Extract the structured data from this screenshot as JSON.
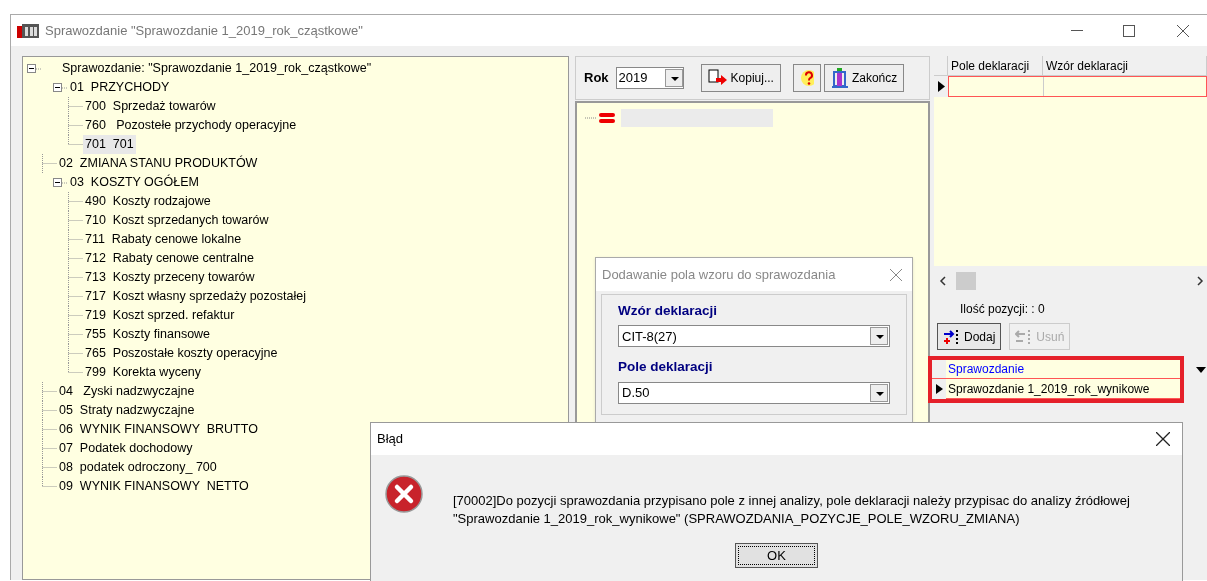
{
  "window": {
    "title": "Sprawozdanie \"Sprawozdanie 1_2019_rok_cząstkowe\""
  },
  "tree": {
    "items": [
      {
        "label": "Sprawozdanie: \"Sprawozdanie 1_2019_rok_cząstkowe\"",
        "expanded": true,
        "selected": false,
        "children": [
          {
            "label": "01  PRZYCHODY",
            "expanded": true,
            "selected": false,
            "children": [
              {
                "label": "700  Sprzedaż towarów",
                "selected": false
              },
              {
                "label": "760   Pozostełe przychody operacyjne",
                "selected": false
              },
              {
                "label": "701  701",
                "selected": true
              }
            ]
          },
          {
            "label": "02  ZMIANA STANU PRODUKTÓW",
            "selected": false
          },
          {
            "label": "03  KOSZTY OGÓŁEM",
            "expanded": true,
            "selected": false,
            "children": [
              {
                "label": "490  Koszty rodzajowe",
                "selected": false
              },
              {
                "label": "710  Koszt sprzedanych towarów",
                "selected": false
              },
              {
                "label": "711  Rabaty cenowe lokalne",
                "selected": false
              },
              {
                "label": "712  Rabaty cenowe centralne",
                "selected": false
              },
              {
                "label": "713  Koszty przeceny towarów",
                "selected": false
              },
              {
                "label": "717  Koszt własny sprzedaży pozostałej",
                "selected": false
              },
              {
                "label": "719  Koszt sprzed. refaktur",
                "selected": false
              },
              {
                "label": "755  Koszty finansowe",
                "selected": false
              },
              {
                "label": "765  Poszostałe koszty operacyjne",
                "selected": false
              },
              {
                "label": "799  Korekta wyceny",
                "selected": false
              }
            ]
          },
          {
            "label": "04   Zyski nadzwyczajne",
            "selected": false
          },
          {
            "label": "05  Straty nadzwyczajne",
            "selected": false
          },
          {
            "label": "06  WYNIK FINANSOWY  BRUTTO",
            "selected": false
          },
          {
            "label": "07  Podatek dochodowy",
            "selected": false
          },
          {
            "label": "08  podatek odroczony_ 700",
            "selected": false
          },
          {
            "label": "09  WYNIK FINANSOWY  NETTO",
            "selected": false
          }
        ]
      }
    ]
  },
  "toolbar": {
    "year_label": "Rok",
    "year": "2019",
    "buttons": [
      {
        "kind": "copy",
        "label": "Kopiuj..."
      },
      {
        "kind": "help"
      },
      {
        "kind": "close",
        "label": "Zakończ"
      }
    ]
  },
  "declaration_grid": {
    "columns": [
      "Pole deklaracji",
      "Wzór deklaracji"
    ]
  },
  "count_label": "Ilość pozycji: : 0",
  "actions": [
    {
      "kind": "add",
      "label": "Dodaj",
      "disabled": false
    },
    {
      "kind": "remove",
      "label": "Usuń",
      "disabled": true
    }
  ],
  "report_grid": {
    "columns": [
      "Sprawozdanie"
    ],
    "rows": [
      "Sprawozdanie 1_2019_rok_wynikowe"
    ]
  },
  "add_dialog": {
    "title": "Dodawanie pola wzoru do sprawozdania",
    "fields": [
      {
        "label": "Wzór deklaracji",
        "value": "CIT-8(27)"
      },
      {
        "label": "Pole deklaracji",
        "value": "D.50"
      }
    ]
  },
  "error_dialog": {
    "title": "Błąd",
    "message": "[70002]Do pozycji sprawozdania przypisano pole z innej analizy, pole deklaracji należy przypisac do analizy źródłowej\n\"Sprawozdanie 1_2019_rok_wynikowe\"  (SPRAWOZDANIA_POZYCJE_POLE_WZORU_ZMIANA)",
    "button": "OK"
  }
}
